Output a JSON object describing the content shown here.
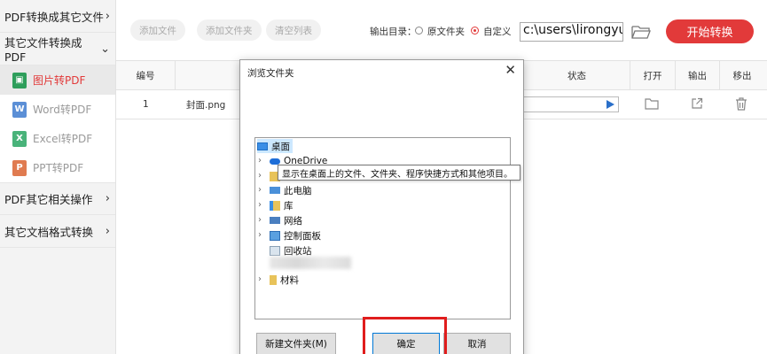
{
  "sidebar": {
    "cat1": "PDF转换成其它文件",
    "cat2": "其它文件转换成PDF",
    "items": [
      {
        "label": "图片转PDF",
        "icon": "image-file-icon",
        "color": "#2e9e5b",
        "glyph": "▣"
      },
      {
        "label": "Word转PDF",
        "icon": "word-file-icon",
        "color": "#5b8fd6",
        "glyph": "W"
      },
      {
        "label": "Excel转PDF",
        "icon": "excel-file-icon",
        "color": "#49b37a",
        "glyph": "X"
      },
      {
        "label": "PPT转PDF",
        "icon": "ppt-file-icon",
        "color": "#e07b50",
        "glyph": "P"
      }
    ],
    "cat3": "PDF其它相关操作",
    "cat4": "其它文档格式转换"
  },
  "toolbar": {
    "add_file": "添加文件",
    "add_folder": "添加文件夹",
    "clear_list": "清空列表",
    "output_label": "输出目录：",
    "opt_source": "原文件夹",
    "opt_custom": "自定义",
    "path_value": "c:\\users\\lirongyu\\",
    "start": "开始转换"
  },
  "table": {
    "headers": {
      "num": "编号",
      "status": "状态",
      "open": "打开",
      "output": "输出",
      "remove": "移出"
    },
    "rows": [
      {
        "num": "1",
        "name": "封面.png",
        "progress": 0
      }
    ]
  },
  "dialog": {
    "title": "浏览文件夹",
    "close": "✕",
    "tree": {
      "desktop": "桌面",
      "onedrive": "OneDrive",
      "pc": "此电脑",
      "library": "库",
      "network": "网络",
      "control": "控制面板",
      "recycle": "回收站",
      "materials": "材料"
    },
    "tooltip": "显示在桌面上的文件、文件夹、程序快捷方式和其他项目。",
    "new_folder": "新建文件夹(M)",
    "ok": "确定",
    "cancel": "取消"
  },
  "colors": {
    "accent": "#e23a3a",
    "selection": "#cce8ff",
    "highlight": "#e01d1d"
  }
}
